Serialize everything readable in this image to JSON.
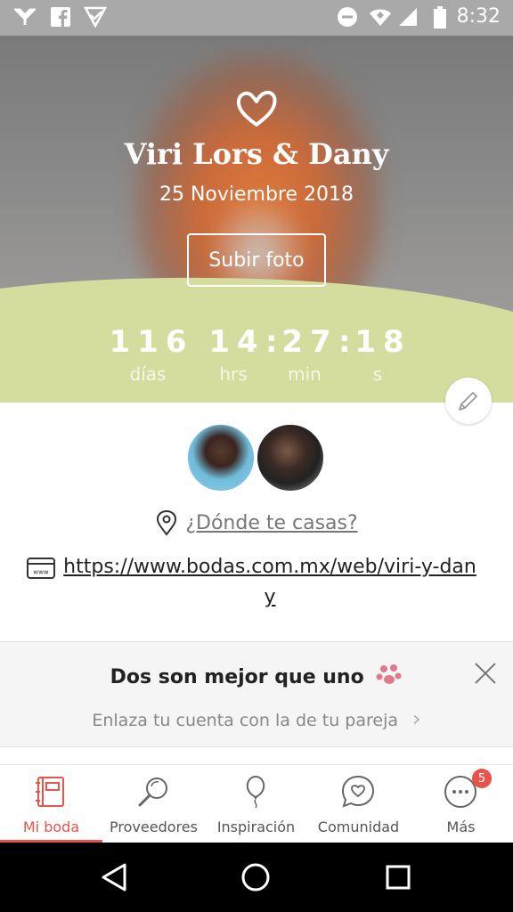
{
  "status_bar": {
    "time": "8:32",
    "icons": [
      "wifi-off-icon",
      "facebook-icon",
      "play-store-icon",
      "do-not-disturb-icon",
      "wifi-icon",
      "signal-icon",
      "battery-icon"
    ]
  },
  "hero": {
    "couple_name": "Viri Lors & Dany",
    "wedding_date": "25 Noviembre 2018",
    "upload_button": "Subir foto",
    "accent_color": "#d4dd9e"
  },
  "countdown": {
    "days": "116",
    "hours": "14",
    "minutes": "27",
    "seconds": "18",
    "separator": ":",
    "labels": {
      "days": "días",
      "hours": "hrs",
      "minutes": "min",
      "seconds": "s"
    }
  },
  "details": {
    "location_prompt": "¿Dónde te casas?",
    "website_url": "https://www.bodas.com.mx/web/viri-y-dany"
  },
  "promo": {
    "title": "Dos son mejor que uno",
    "subtitle": "Enlaza tu cuenta con la de tu pareja",
    "chevron": "›"
  },
  "bottom_nav": {
    "items": [
      {
        "label": "Mi boda",
        "icon": "notebook-icon",
        "active": true
      },
      {
        "label": "Proveedores",
        "icon": "search-icon",
        "active": false
      },
      {
        "label": "Inspiración",
        "icon": "balloon-icon",
        "active": false
      },
      {
        "label": "Comunidad",
        "icon": "chat-heart-icon",
        "active": false
      },
      {
        "label": "Más",
        "icon": "more-icon",
        "active": false,
        "badge": "5"
      }
    ],
    "active_color": "#e8534a"
  }
}
